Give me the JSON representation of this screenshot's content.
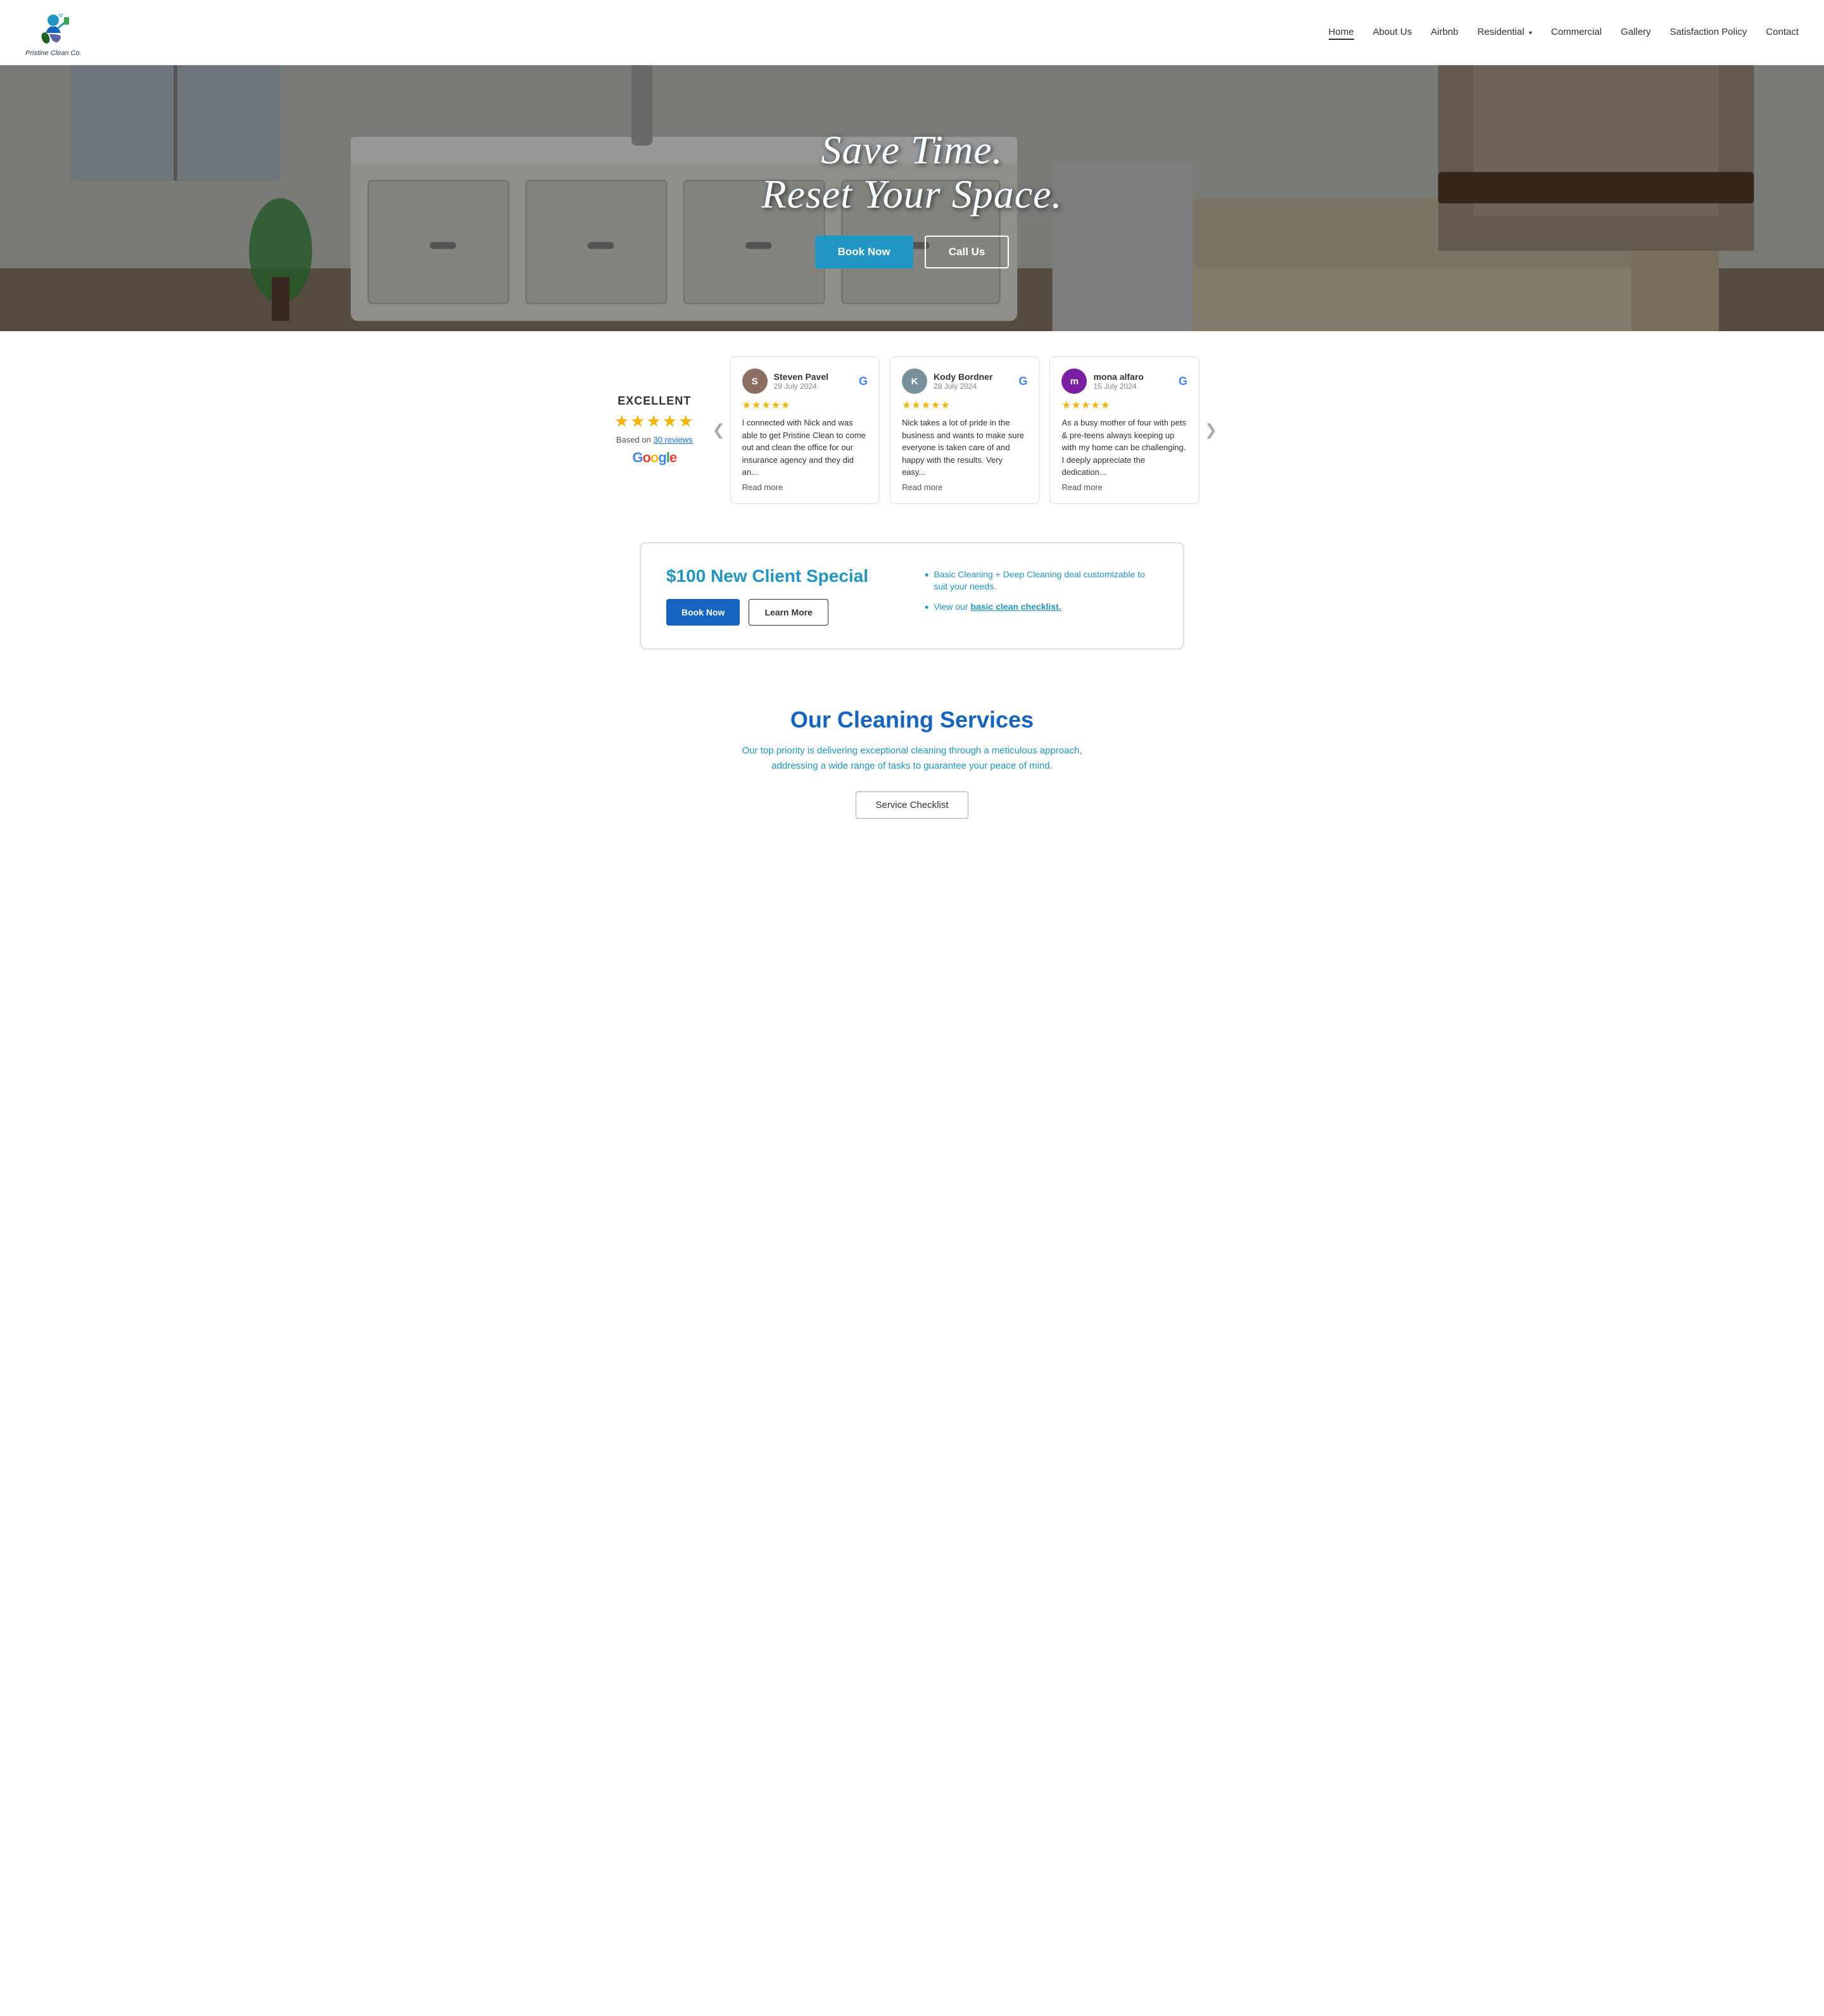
{
  "brand": {
    "name": "Pristine Clean Co.",
    "logo_alt": "Pristine Clean Co. logo"
  },
  "nav": {
    "links": [
      {
        "id": "home",
        "label": "Home",
        "active": true,
        "has_dropdown": false
      },
      {
        "id": "about",
        "label": "About Us",
        "active": false,
        "has_dropdown": false
      },
      {
        "id": "airbnb",
        "label": "Airbnb",
        "active": false,
        "has_dropdown": false
      },
      {
        "id": "residential",
        "label": "Residential",
        "active": false,
        "has_dropdown": true
      },
      {
        "id": "commercial",
        "label": "Commercial",
        "active": false,
        "has_dropdown": false
      },
      {
        "id": "gallery",
        "label": "Gallery",
        "active": false,
        "has_dropdown": false
      },
      {
        "id": "satisfaction",
        "label": "Satisfaction Policy",
        "active": false,
        "has_dropdown": false
      },
      {
        "id": "contact",
        "label": "Contact",
        "active": false,
        "has_dropdown": false
      }
    ]
  },
  "hero": {
    "line1": "Save Time.",
    "line2": "Reset Your Space.",
    "btn_book": "Book Now",
    "btn_call": "Call Us"
  },
  "reviews": {
    "rating_label": "EXCELLENT",
    "stars": "★★★★★",
    "based_on": "Based on",
    "review_count": "30 reviews",
    "google_label": "Google",
    "items": [
      {
        "name": "Steven Pavel",
        "date": "29 July 2024",
        "stars": "★★★★★",
        "avatar_letter": "S",
        "avatar_color": "#8d6e63",
        "text": "I connected with Nick and was able to get Pristine Clean to come out and clean the office for our insurance agency and they did an...",
        "read_more": "Read more"
      },
      {
        "name": "Kody Bordner",
        "date": "28 July 2024",
        "stars": "★★★★★",
        "avatar_letter": "K",
        "avatar_color": "#78909c",
        "text": "Nick takes a lot of pride in the business and wants to make sure everyone is taken care of and happy with the results. Very easy...",
        "read_more": "Read more"
      },
      {
        "name": "mona alfaro",
        "date": "15 July 2024",
        "stars": "★★★★★",
        "avatar_letter": "m",
        "avatar_color": "#7b1fa2",
        "text": "As a busy mother of four with pets & pre-teens always keeping up with my home can be challenging. I deeply appreciate the dedication...",
        "read_more": "Read more"
      }
    ]
  },
  "promo": {
    "title": "$100 New Client Special",
    "btn_book": "Book Now",
    "btn_learn": "Learn More",
    "bullets": [
      {
        "text": "Basic Cleaning + Deep Cleaning deal customizable to suit your needs."
      },
      {
        "prefix": "View our ",
        "link_text": "basic clean checklist.",
        "suffix": ""
      }
    ]
  },
  "services": {
    "title": "Our Cleaning Services",
    "subtitle": "Our top priority is delivering exceptional cleaning through a meticulous approach, addressing a wide range of tasks to guarantee your peace of mind.",
    "btn_checklist": "Service Checklist"
  },
  "icons": {
    "chevron_down": "▾",
    "star": "★",
    "bullet": "•",
    "prev": "❮",
    "next": "❯"
  }
}
